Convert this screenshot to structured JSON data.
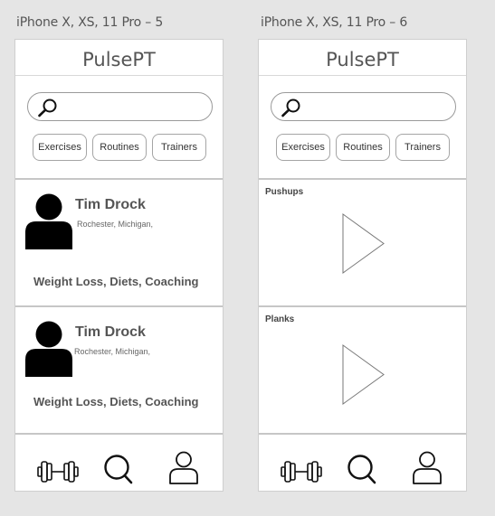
{
  "artboards": [
    {
      "title": "iPhone X, XS, 11 Pro – 5",
      "brand": "PulsePT",
      "chips": [
        "Exercises",
        "Routines",
        "Trainers"
      ],
      "trainers": [
        {
          "name": "Tim Drock",
          "location": "Rochester, Michigan,",
          "tags": "Weight Loss, Diets, Coaching"
        },
        {
          "name": "Tim Drock",
          "location": "Rochester, Michigan,",
          "tags": "Weight Loss, Diets, Coaching"
        }
      ],
      "nav": [
        "dumbbell-icon",
        "search-icon",
        "profile-icon"
      ]
    },
    {
      "title": "iPhone X, XS, 11 Pro – 6",
      "brand": "PulsePT",
      "chips": [
        "Exercises",
        "Routines",
        "Trainers"
      ],
      "videos": [
        {
          "title": "Pushups"
        },
        {
          "title": "Planks"
        }
      ],
      "nav": [
        "dumbbell-icon",
        "search-icon",
        "profile-icon"
      ]
    }
  ],
  "colors": {
    "canvas": "#e5e5e5",
    "phone": "#ffffff",
    "text": "#555555",
    "icon": "#000000"
  }
}
